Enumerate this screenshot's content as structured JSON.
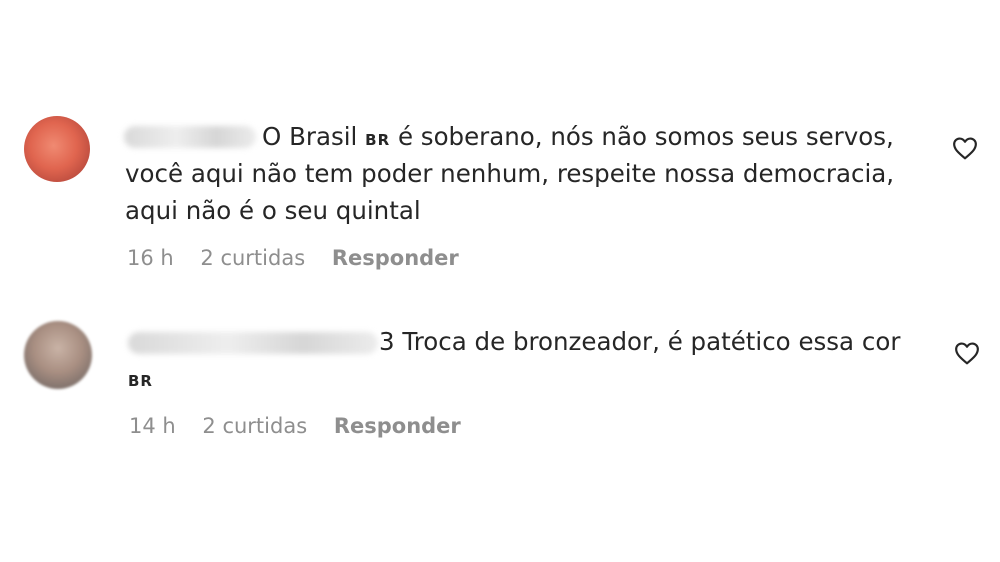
{
  "comments": [
    {
      "text_lines": [
        "O Brasil",
        "é soberano, nós não somos seus servos,",
        "você aqui não tem poder nenhum, respeite nossa democracia,",
        "aqui não é o seu quintal"
      ],
      "flag": "BR",
      "time": "16 h",
      "likes": "2 curtidas",
      "reply_label": "Responder"
    },
    {
      "text_lines": [
        "3 Troca de bronzeador, é patético essa cor"
      ],
      "flag": "BR",
      "time": "14 h",
      "likes": "2 curtidas",
      "reply_label": "Responder"
    }
  ],
  "icons": {
    "like": "heart-icon"
  },
  "colors": {
    "text": "#262626",
    "meta": "#8e8e8e"
  }
}
